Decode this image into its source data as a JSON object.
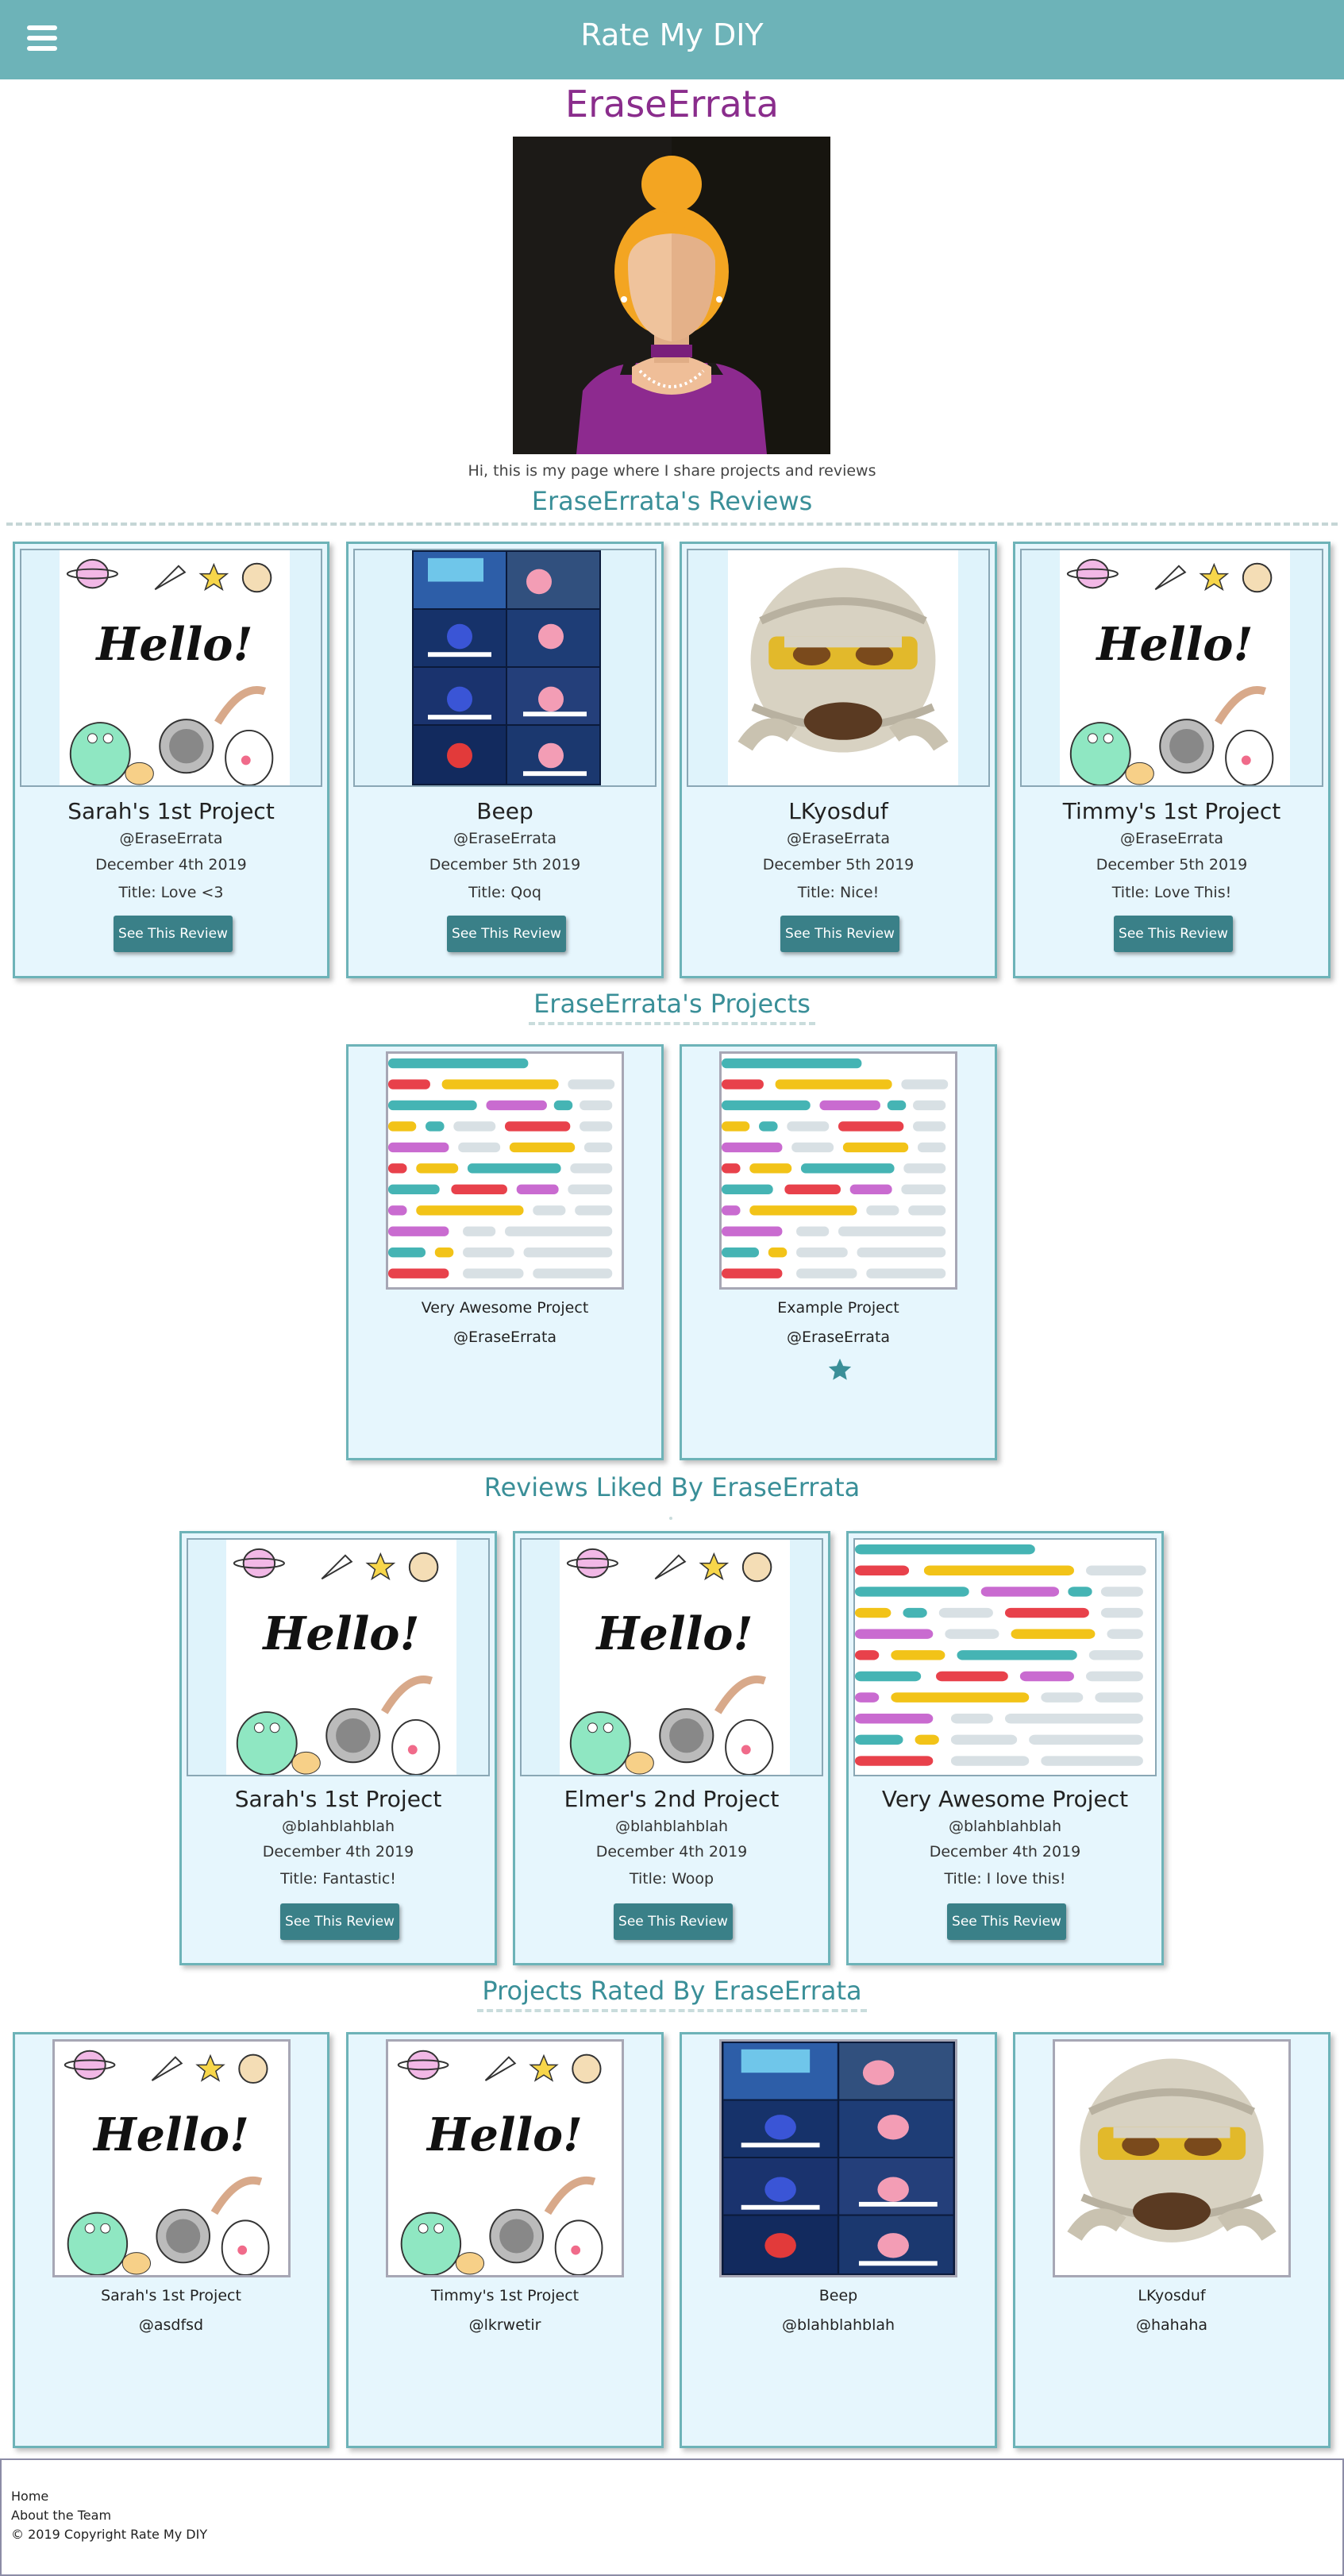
{
  "header": {
    "title": "Rate My DIY",
    "menu_icon": "hamburger-menu-icon"
  },
  "profile": {
    "username": "EraseErrata",
    "bio": "Hi, this is my page where I share projects and reviews"
  },
  "sections": {
    "reviews": "EraseErrata's Reviews",
    "projects": "EraseErrata's Projects",
    "liked": "Reviews Liked By EraseErrata",
    "rated": "Projects Rated By EraseErrata"
  },
  "reviews": [
    {
      "project": "Sarah's 1st Project",
      "user": "@EraseErrata",
      "date": "December 4th 2019",
      "title": "Title: Love <3",
      "button": "See This Review"
    },
    {
      "project": "Beep",
      "user": "@EraseErrata",
      "date": "December 5th 2019",
      "title": "Title: Qoq",
      "button": "See This Review"
    },
    {
      "project": "LKyosduf",
      "user": "@EraseErrata",
      "date": "December 5th 2019",
      "title": "Title: Nice!",
      "button": "See This Review"
    },
    {
      "project": "Timmy's 1st Project",
      "user": "@EraseErrata",
      "date": "December 5th 2019",
      "title": "Title: Love This!",
      "button": "See This Review"
    }
  ],
  "projects": [
    {
      "name": "Very Awesome Project",
      "user": "@EraseErrata"
    },
    {
      "name": "Example Project",
      "user": "@EraseErrata",
      "rating_icon": "star-icon"
    }
  ],
  "liked": [
    {
      "project": "Sarah's 1st Project",
      "user": "@blahblahblah",
      "date": "December 4th 2019",
      "title": "Title: Fantastic!",
      "button": "See This Review"
    },
    {
      "project": "Elmer's 2nd Project",
      "user": "@blahblahblah",
      "date": "December 4th 2019",
      "title": "Title: Woop",
      "button": "See This Review"
    },
    {
      "project": "Very Awesome Project",
      "user": "@blahblahblah",
      "date": "December 4th 2019",
      "title": "Title: I love this!",
      "button": "See This Review"
    }
  ],
  "rated": [
    {
      "name": "Sarah's 1st Project",
      "user": "@asdfsd"
    },
    {
      "name": "Timmy's 1st Project",
      "user": "@lkrwetir"
    },
    {
      "name": "Beep",
      "user": "@blahblahblah"
    },
    {
      "name": "LKyosduf",
      "user": "@hahaha"
    }
  ],
  "hello_text": "Hello!",
  "footer": {
    "home": "Home",
    "about": "About the Team",
    "copyright": "© 2019 Copyright Rate My DIY"
  },
  "colors": {
    "header": "#6db3b8",
    "username": "#8a2d8c",
    "section_title": "#3a8f98",
    "card_bg": "#e6f6fd",
    "button": "#3a8088"
  }
}
